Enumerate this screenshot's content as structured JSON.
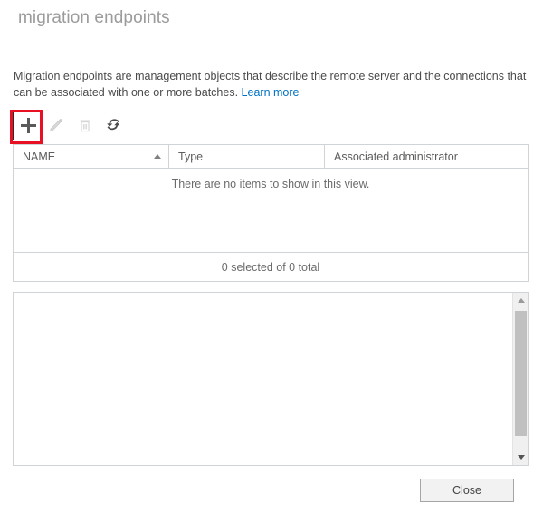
{
  "page": {
    "title": "migration endpoints",
    "description_text": "Migration endpoints are management objects that describe the remote server and the connections that can be associated with one or more batches.",
    "learn_more_label": "Learn more"
  },
  "toolbar": {
    "items": [
      {
        "name": "new-button",
        "icon": "plus-icon",
        "label": "",
        "enabled": true,
        "highlighted": true
      },
      {
        "name": "edit-button",
        "icon": "pencil-icon",
        "label": "",
        "enabled": false,
        "highlighted": false
      },
      {
        "name": "delete-button",
        "icon": "trash-icon",
        "label": "",
        "enabled": false,
        "highlighted": false
      },
      {
        "name": "refresh-button",
        "icon": "refresh-icon",
        "label": "",
        "enabled": true,
        "highlighted": false
      }
    ],
    "highlight_color": "#e81123"
  },
  "list": {
    "columns": [
      {
        "label": "NAME",
        "sorted": "ascending"
      },
      {
        "label": "Type",
        "sorted": "none"
      },
      {
        "label": "Associated administrator",
        "sorted": "none"
      }
    ],
    "rows": [],
    "empty_message": "There are no items to show in this view.",
    "status_text": "0 selected of 0 total",
    "selected_count": 0,
    "total_count": 0
  },
  "detail_pane": {
    "content": "",
    "scrollbar": {
      "up_arrow": "caret-up-icon",
      "down_arrow": "caret-down-icon",
      "thumb_visible": true
    }
  },
  "footer": {
    "close_label": "Close"
  },
  "colors": {
    "link": "#0072c6",
    "border": "#d0d4d7",
    "title": "#9b9b9b",
    "highlight": "#e81123"
  }
}
